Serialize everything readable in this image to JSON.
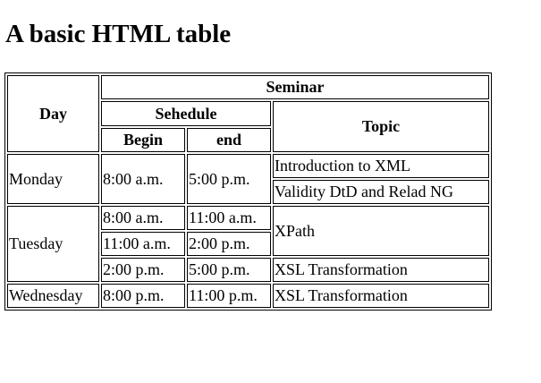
{
  "title": "A basic HTML table",
  "table": {
    "headers": {
      "day": "Day",
      "seminar": "Seminar",
      "schedule": "Sehedule",
      "topic": "Topic",
      "begin": "Begin",
      "end": "end"
    },
    "rows": {
      "monday": {
        "day": "Monday",
        "begin": "8:00 a.m.",
        "end": "5:00 p.m.",
        "topic1": "Introduction to XML",
        "topic2": "Validity DtD and Relad NG"
      },
      "tuesday": {
        "day": "Tuesday",
        "slot1_begin": "8:00 a.m.",
        "slot1_end": "11:00 a.m.",
        "slot1_topic": "XPath",
        "slot2_begin": "11:00 a.m.",
        "slot2_end": "2:00 p.m.",
        "slot3_begin": "2:00 p.m.",
        "slot3_end": "5:00 p.m.",
        "slot3_topic": "XSL Transformation"
      },
      "wednesday": {
        "day": "Wednesday",
        "begin": "8:00 p.m.",
        "end": "11:00 p.m.",
        "topic": "XSL Transformation"
      }
    }
  }
}
